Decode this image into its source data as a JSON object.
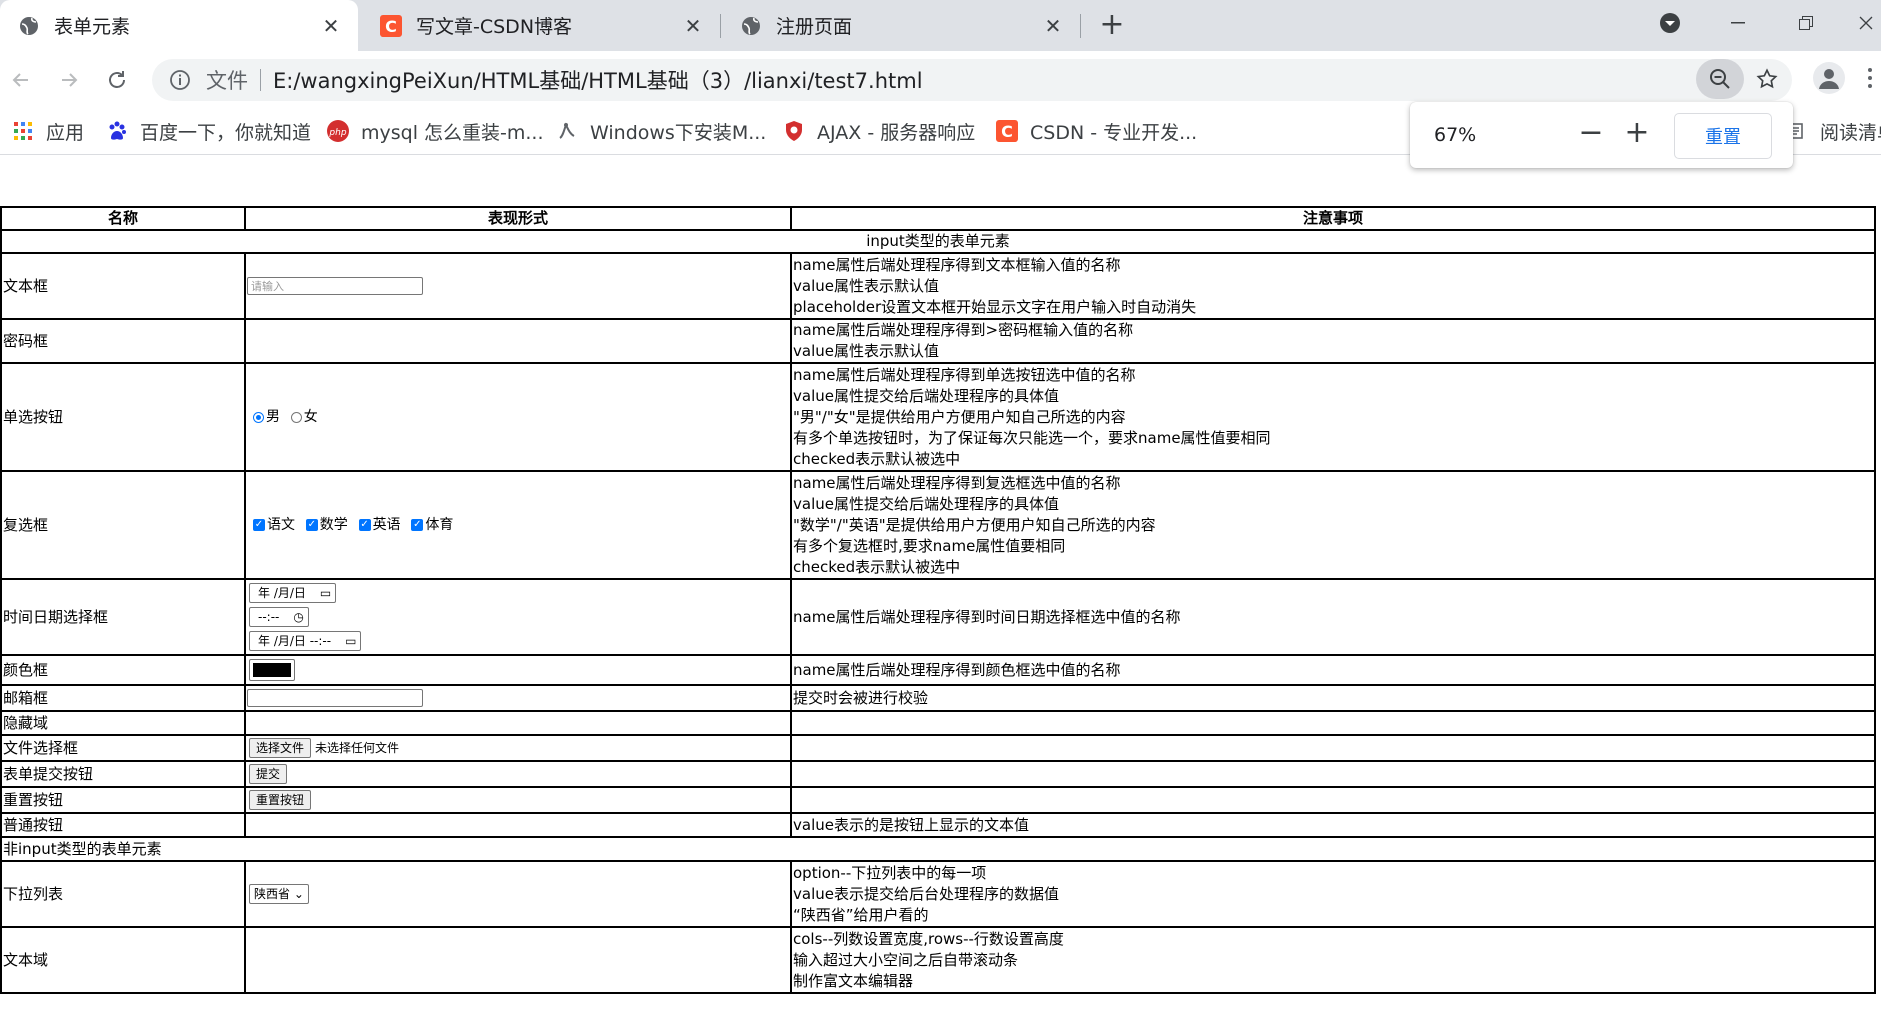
{
  "browser": {
    "tabs": [
      {
        "title": "表单元素",
        "icon": "globe-icon",
        "active": true
      },
      {
        "title": "写文章-CSDN博客",
        "icon": "csdn-icon",
        "active": false
      },
      {
        "title": "注册页面",
        "icon": "globe-icon",
        "active": false
      }
    ],
    "address": {
      "scheme_label": "文件",
      "url": "E:/wangxingPeiXun/HTML基础/HTML基础（3）/lianxi/test7.html"
    },
    "bookmarks": [
      {
        "label": "应用",
        "icon": "apps-grid-icon"
      },
      {
        "label": "百度一下，你就知道",
        "icon": "baidu-icon"
      },
      {
        "label": "mysql 怎么重装-m...",
        "icon": "php-icon"
      },
      {
        "label": "Windows下安装M...",
        "icon": "bookmark-icon"
      },
      {
        "label": "AJAX - 服务器响应",
        "icon": "shield-icon"
      },
      {
        "label": "CSDN - 专业开发...",
        "icon": "csdn-icon"
      },
      {
        "label": "阅读清单",
        "icon": "reading-list-icon"
      }
    ],
    "zoom": {
      "value": "67%",
      "minus": "−",
      "plus": "+",
      "reset": "重置"
    }
  },
  "table": {
    "headers": [
      "名称",
      "表现形式",
      "注意事项"
    ],
    "section1": "input类型的表单元素",
    "section2": "非input类型的表单元素",
    "rows": {
      "text": {
        "name": "文本框",
        "placeholder": "请输入",
        "notes": [
          "name属性后端处理程序得到文本框输入值的名称",
          "value属性表示默认值",
          "placeholder设置文本框开始显示文字在用户输入时自动消失"
        ]
      },
      "password": {
        "name": "密码框",
        "notes": [
          "name属性后端处理程序得到>密码框输入值的名称",
          "value属性表示默认值"
        ]
      },
      "radio": {
        "name": "单选按钮",
        "options": [
          "男",
          "女"
        ],
        "notes": [
          "name属性后端处理程序得到单选按钮选中值的名称",
          "value属性提交给后端处理程序的具体值",
          "\"男\"/\"女\"是提供给用户方便用户知自己所选的内容",
          "有多个单选按钮时，为了保证每次只能选一个，要求name属性值要相同",
          "checked表示默认被选中"
        ]
      },
      "checkbox": {
        "name": "复选框",
        "options": [
          "语文",
          "数学",
          "英语",
          "体育"
        ],
        "notes": [
          "name属性后端处理程序得到复选框选中值的名称",
          "value属性提交给后端处理程序的具体值",
          "\"数学\"/\"英语\"是提供给用户方便用户知自己所选的内容",
          "有多个复选框时,要求name属性值要相同",
          "checked表示默认被选中"
        ]
      },
      "datetime": {
        "name": "时间日期选择框",
        "date": "年 /月/日",
        "time": "--:--",
        "datetime": "年 /月/日  --:--",
        "notes": [
          "name属性后端处理程序得到时间日期选择框选中值的名称"
        ]
      },
      "color": {
        "name": "颜色框",
        "value": "#000000",
        "notes": [
          "name属性后端处理程序得到颜色框选中值的名称"
        ]
      },
      "email": {
        "name": "邮箱框",
        "notes": [
          "提交时会被进行校验"
        ]
      },
      "hidden": {
        "name": "隐藏域"
      },
      "file": {
        "name": "文件选择框",
        "button": "选择文件",
        "status": "未选择任何文件"
      },
      "submit": {
        "name": "表单提交按钮",
        "button": "提交"
      },
      "reset": {
        "name": "重置按钮",
        "button": "重置按钮"
      },
      "button": {
        "name": "普通按钮",
        "notes": [
          "value表示的是按钮上显示的文本值"
        ]
      },
      "select": {
        "name": "下拉列表",
        "selected": "陕西省",
        "notes": [
          "option--下拉列表中的每一项",
          "value表示提交给后台处理程序的数据值",
          "“陕西省”给用户看的"
        ]
      },
      "textarea": {
        "name": "文本域",
        "notes": [
          "cols--列数设置宽度,rows--行数设置高度",
          "输入超过大小空间之后自带滚动条",
          "制作富文本编辑器"
        ]
      }
    }
  }
}
